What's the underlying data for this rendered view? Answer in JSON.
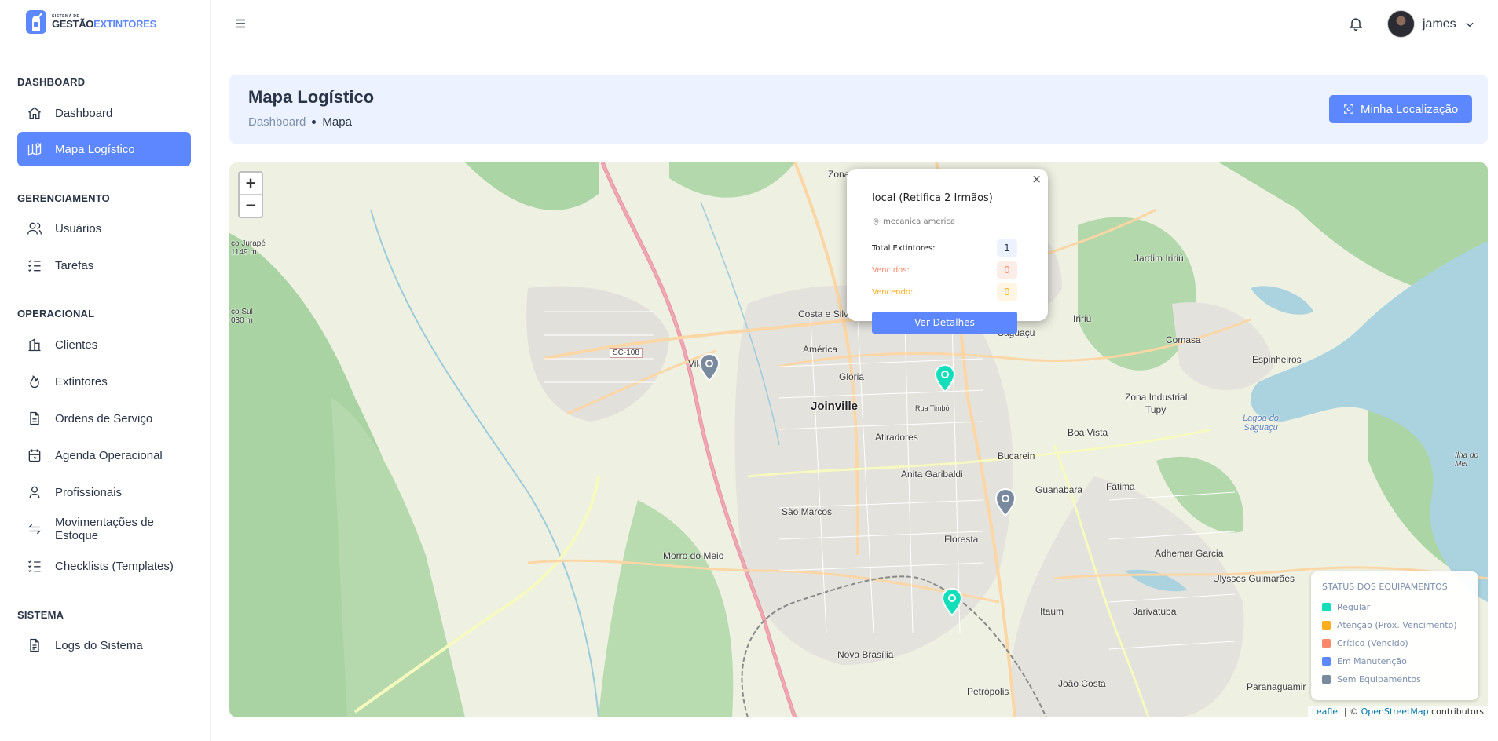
{
  "app": {
    "logo_small": "SISTEMA DE",
    "logo_main": "GESTÃO",
    "logo_accent": "EXTINTORES"
  },
  "sidebar": {
    "sections": [
      {
        "title": "DASHBOARD"
      },
      {
        "title": "GERENCIAMENTO"
      },
      {
        "title": "OPERACIONAL"
      },
      {
        "title": "SISTEMA"
      }
    ],
    "items": [
      {
        "label": "Dashboard",
        "icon": "home-icon"
      },
      {
        "label": "Mapa Logístico",
        "icon": "map-icon",
        "active": true
      },
      {
        "label": "Usuários",
        "icon": "users-icon"
      },
      {
        "label": "Tarefas",
        "icon": "list-check-icon"
      },
      {
        "label": "Clientes",
        "icon": "building-icon"
      },
      {
        "label": "Extintores",
        "icon": "flame-icon"
      },
      {
        "label": "Ordens de Serviço",
        "icon": "file-icon"
      },
      {
        "label": "Agenda Operacional",
        "icon": "calendar-icon"
      },
      {
        "label": "Profissionais",
        "icon": "user-icon"
      },
      {
        "label": "Movimentações de Estoque",
        "icon": "transfer-icon"
      },
      {
        "label": "Checklists (Templates)",
        "icon": "list-check-icon"
      },
      {
        "label": "Logs do Sistema",
        "icon": "file-text-icon"
      }
    ]
  },
  "topbar": {
    "user_name": "james"
  },
  "header": {
    "title": "Mapa Logístico",
    "breadcrumb_home": "Dashboard",
    "breadcrumb_current": "Mapa",
    "location_button": "Minha Localização"
  },
  "map": {
    "zoom_in": "+",
    "zoom_out": "−",
    "labels": {
      "joinville": "Joinville",
      "america": "América",
      "saguacu": "Saguaçu",
      "gloria": "Glória",
      "atiradores": "Atiradores",
      "bucarein": "Bucarein",
      "anita": "Anita Garibaldi",
      "guanabara": "Guanabara",
      "fatima": "Fátima",
      "floresta": "Floresta",
      "saomarcos": "São Marcos",
      "morro": "Morro do Meio",
      "novabrasilia": "Nova Brasília",
      "petropolis": "Petrópolis",
      "joaocosta": "João Costa",
      "itaum": "Itaum",
      "jarivatuba": "Jarivatuba",
      "adhemar": "Adhemar Garcia",
      "ulysses": "Ulysses Guimarães",
      "paranaguamirim": "Paranaguamir",
      "boavista": "Boa Vista",
      "zonaind": "Zona Industrial",
      "tupy": "Tupy",
      "iririu": "Iririú",
      "jardimiririu": "Jardim Iririú",
      "comasa": "Comasa",
      "espinheiros": "Espinheiros",
      "costasilva": "Costa e Silv",
      "vila": "Vila",
      "zona": "Zona",
      "sc108": "SC-108",
      "lagoa": "Lagoa do Saguaçu",
      "ilhamel": "Ilha do Mel",
      "jurape": "co Jurapé 1149 m",
      "sul": "co Sul 030 m",
      "ruatimbo": "Rua Timbó"
    },
    "popup": {
      "title": "local (Retifica 2 Irmãos)",
      "address": "mecanica america",
      "total_label": "Total Extintores:",
      "total_value": "1",
      "vencidos_label": "Vencidos:",
      "vencidos_value": "0",
      "vencendo_label": "Vencendo:",
      "vencendo_value": "0",
      "button": "Ver Detalhes",
      "close": "×"
    },
    "legend": {
      "title": "STATUS DOS EQUIPAMENTOS",
      "items": [
        {
          "label": "Regular",
          "color": "#13deb9"
        },
        {
          "label": "Atenção (Próx. Vencimento)",
          "color": "#ffae1f"
        },
        {
          "label": "Crítico (Vencido)",
          "color": "#fa896b"
        },
        {
          "label": "Em Manutenção",
          "color": "#5d87ff"
        },
        {
          "label": "Sem Equipamentos",
          "color": "#7a8a9e"
        }
      ]
    },
    "attribution": {
      "leaflet": "Leaflet",
      "sep": " | © ",
      "osm": "OpenStreetMap",
      "contrib": " contributors"
    }
  },
  "colors": {
    "primary": "#5d87ff",
    "regular": "#13deb9",
    "gray_marker": "#7a8a9e"
  }
}
